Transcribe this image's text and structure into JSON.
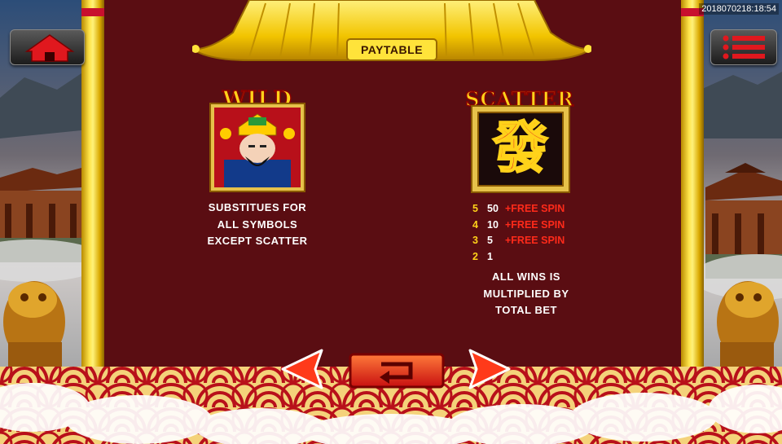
{
  "screen": {
    "timestamp": "2018070218:18:54",
    "title": "PAYTABLE"
  },
  "buttons": {
    "home": "home-icon",
    "menu": "menu-list-icon",
    "prev": "arrow-left-icon",
    "back": "return-arrow-icon",
    "next": "arrow-right-icon"
  },
  "wild": {
    "label": "WILD",
    "desc_line1": "SUBSTITUES FOR",
    "desc_line2": "ALL SYMBOLS",
    "desc_line3": "EXCEPT SCATTER"
  },
  "scatter": {
    "label": "SCATTER",
    "glyph": "發",
    "payouts": [
      {
        "count": "5",
        "value": "50",
        "bonus": "+FREE SPIN"
      },
      {
        "count": "4",
        "value": "10",
        "bonus": "+FREE SPIN"
      },
      {
        "count": "3",
        "value": "5",
        "bonus": "+FREE SPIN"
      },
      {
        "count": "2",
        "value": "1",
        "bonus": ""
      }
    ],
    "note_line1": "ALL WINS IS",
    "note_line2": "MULTIPLIED BY",
    "note_line3": "TOTAL BET"
  },
  "colors": {
    "panel": "#5a0d12",
    "gold": "#ffd21a",
    "free_spin": "#ff2a1a"
  }
}
